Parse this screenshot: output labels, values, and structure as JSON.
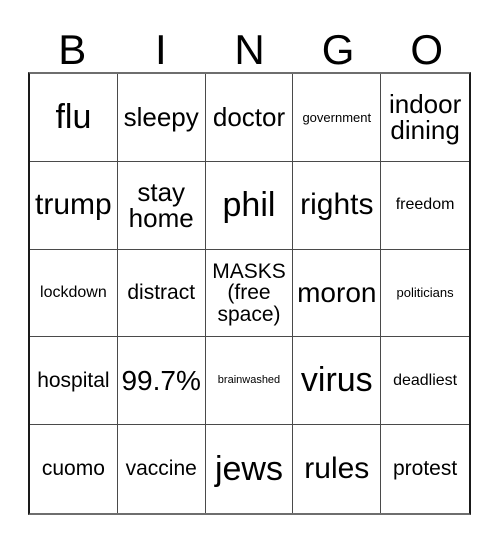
{
  "header": {
    "letters": [
      "B",
      "I",
      "N",
      "G",
      "O"
    ]
  },
  "grid": {
    "rows": 5,
    "columns": 5,
    "cells": [
      {
        "text": "flu",
        "size": "fs-xxl"
      },
      {
        "text": "sleepy",
        "size": "fs-lg"
      },
      {
        "text": "doctor",
        "size": "fs-lg"
      },
      {
        "text": "government",
        "size": "fs-xs"
      },
      {
        "text": "indoor\ndining",
        "size": "fs-lg"
      },
      {
        "text": "trump",
        "size": "fs-xl"
      },
      {
        "text": "stay\nhome",
        "size": "fs-lg"
      },
      {
        "text": "phil",
        "size": "fs-xxl"
      },
      {
        "text": "rights",
        "size": "fs-xl"
      },
      {
        "text": "freedom",
        "size": "fs-sm"
      },
      {
        "text": "lockdown",
        "size": "fs-sm"
      },
      {
        "text": "distract",
        "size": "fs-md"
      },
      {
        "text": "MASKS\n(free\nspace)",
        "size": "fs-md"
      },
      {
        "text": "moron",
        "size": "fs-xl"
      },
      {
        "text": "politicians",
        "size": "fs-xs"
      },
      {
        "text": "hospital",
        "size": "fs-md"
      },
      {
        "text": "99.7%",
        "size": "fs-xl"
      },
      {
        "text": "brainwashed",
        "size": "fs-xxs"
      },
      {
        "text": "virus",
        "size": "fs-xxl"
      },
      {
        "text": "deadliest",
        "size": "fs-sm"
      },
      {
        "text": "cuomo",
        "size": "fs-md"
      },
      {
        "text": "vaccine",
        "size": "fs-md"
      },
      {
        "text": "jews",
        "size": "fs-xxl"
      },
      {
        "text": "rules",
        "size": "fs-xl"
      },
      {
        "text": "protest",
        "size": "fs-md"
      }
    ]
  },
  "colors": {
    "background": "#ffffff",
    "text": "#000000",
    "grid_line": "#4a4a4a",
    "grid_outer": "#1a1a1a"
  }
}
